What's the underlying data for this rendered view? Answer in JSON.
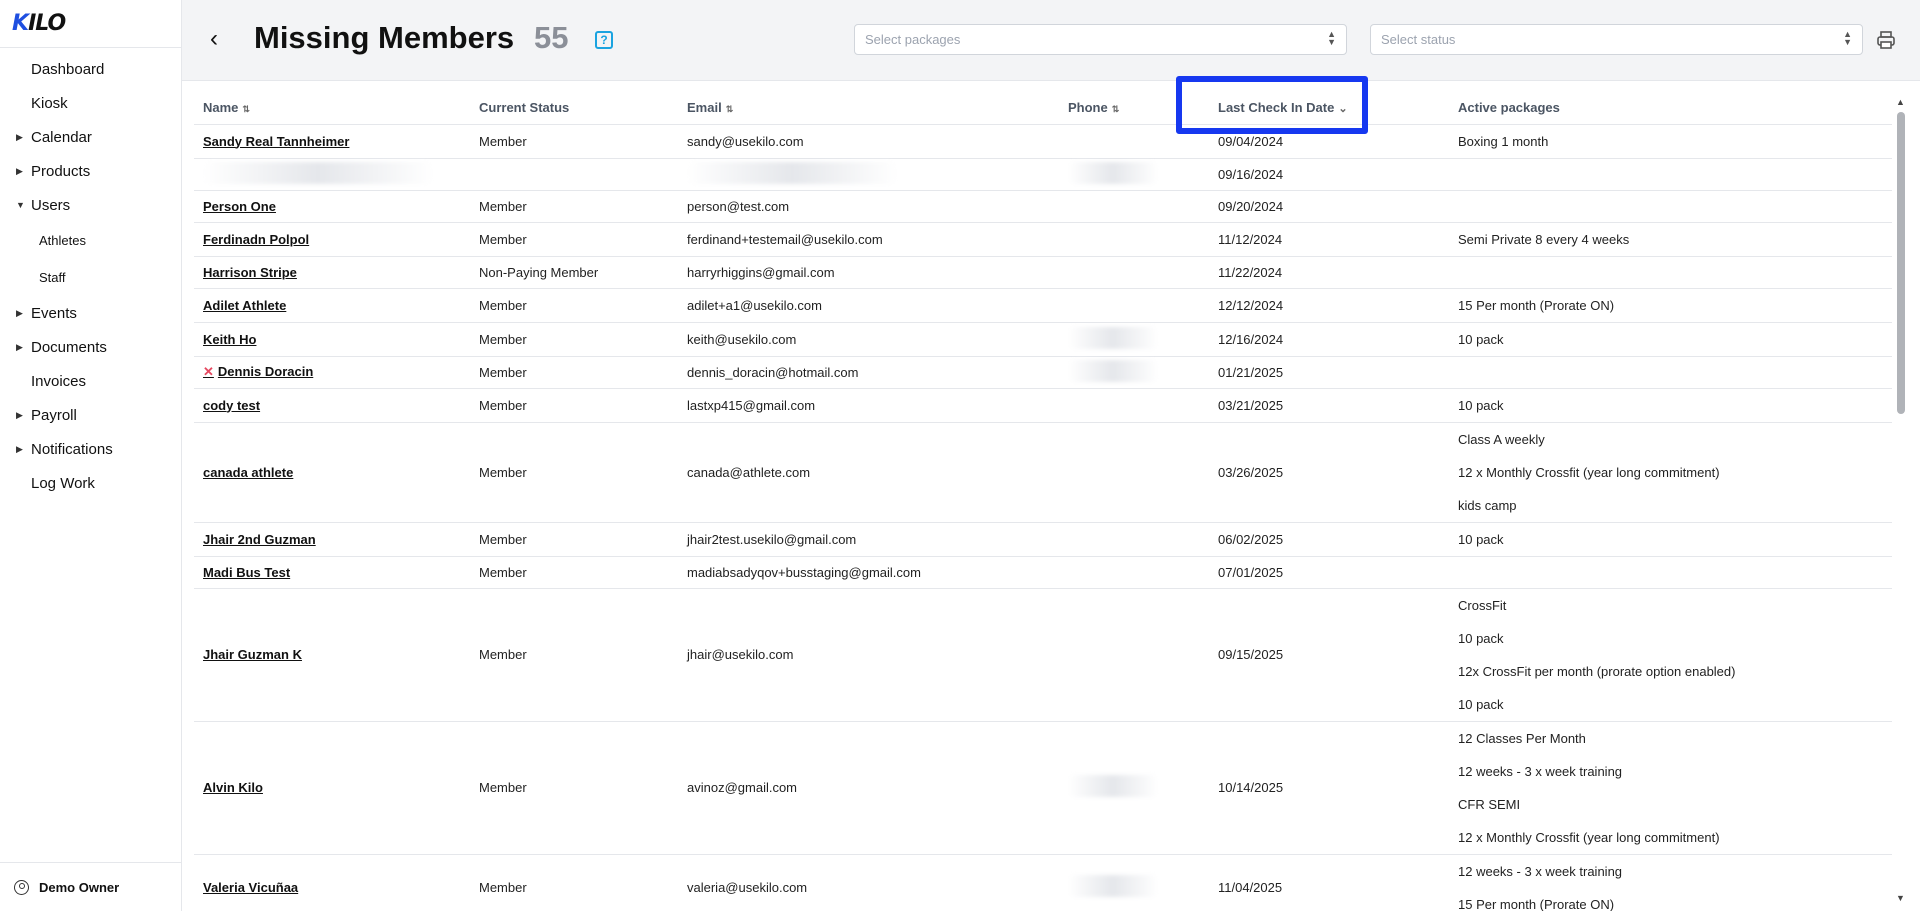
{
  "sidebar": {
    "logo": "KILO",
    "items": [
      {
        "label": "Dashboard"
      },
      {
        "label": "Kiosk"
      },
      {
        "label": "Calendar"
      },
      {
        "label": "Products"
      },
      {
        "label": "Users"
      },
      {
        "label": "Athletes"
      },
      {
        "label": "Staff"
      },
      {
        "label": "Events"
      },
      {
        "label": "Documents"
      },
      {
        "label": "Invoices"
      },
      {
        "label": "Payroll"
      },
      {
        "label": "Notifications"
      },
      {
        "label": "Log Work"
      }
    ],
    "user": "Demo Owner"
  },
  "header": {
    "title": "Missing Members",
    "count": "55",
    "help": "?",
    "packages_placeholder": "Select packages",
    "status_placeholder": "Select status"
  },
  "table": {
    "columns": [
      "Name",
      "Current Status",
      "Email",
      "Phone",
      "Last Check In Date",
      "Active packages"
    ],
    "rows": [
      {
        "name": "Sandy Real Tannheimer",
        "status": "Member",
        "email": "sandy@usekilo.com",
        "date": "09/04/2024",
        "packages": [
          "Boxing 1 month"
        ]
      },
      {
        "name": "",
        "status": "",
        "email": "",
        "date": "09/16/2024",
        "packages": []
      },
      {
        "name": "Person One",
        "status": "Member",
        "email": "person@test.com",
        "date": "09/20/2024",
        "packages": []
      },
      {
        "name": "Ferdinadn Polpol",
        "status": "Member",
        "email": "ferdinand+testemail@usekilo.com",
        "date": "11/12/2024",
        "packages": [
          "Semi Private 8 every 4 weeks"
        ]
      },
      {
        "name": "Harrison Stripe",
        "status": "Non-Paying Member",
        "email": "harryrhiggins@gmail.com",
        "date": "11/22/2024",
        "packages": []
      },
      {
        "name": "Adilet Athlete",
        "status": "Member",
        "email": "adilet+a1@usekilo.com",
        "date": "12/12/2024",
        "packages": [
          "15 Per month (Prorate ON)"
        ]
      },
      {
        "name": "Keith Ho",
        "status": "Member",
        "email": "keith@usekilo.com",
        "date": "12/16/2024",
        "packages": [
          "10 pack"
        ]
      },
      {
        "name": "Dennis Doracin",
        "status": "Member",
        "email": "dennis_doracin@hotmail.com",
        "date": "01/21/2025",
        "packages": []
      },
      {
        "name": "cody test",
        "status": "Member",
        "email": "lastxp415@gmail.com",
        "date": "03/21/2025",
        "packages": [
          "10 pack"
        ]
      },
      {
        "name": "canada athlete",
        "status": "Member",
        "email": "canada@athlete.com",
        "date": "03/26/2025",
        "packages": [
          "Class A weekly",
          "12 x Monthly Crossfit (year long commitment)",
          "kids camp"
        ]
      },
      {
        "name": "Jhair 2nd Guzman",
        "status": "Member",
        "email": "jhair2test.usekilo@gmail.com",
        "date": "06/02/2025",
        "packages": [
          "10 pack"
        ]
      },
      {
        "name": "Madi Bus Test",
        "status": "Member",
        "email": "madiabsadyqov+busstaging@gmail.com",
        "date": "07/01/2025",
        "packages": []
      },
      {
        "name": "Jhair Guzman K",
        "status": "Member",
        "email": "jhair@usekilo.com",
        "date": "09/15/2025",
        "packages": [
          "CrossFit",
          "10 pack",
          "12x CrossFit per month (prorate option enabled)",
          "10 pack"
        ]
      },
      {
        "name": "Alvin Kilo",
        "status": "Member",
        "email": "avinoz@gmail.com",
        "date": "10/14/2025",
        "packages": [
          "12 Classes Per Month",
          "12 weeks - 3 x week training",
          "CFR SEMI",
          "12 x Monthly Crossfit (year long commitment)"
        ]
      },
      {
        "name": "Valeria Vicuñaa",
        "status": "Member",
        "email": "valeria@usekilo.com",
        "date": "11/04/2025",
        "packages": [
          "12 weeks - 3 x week training",
          "15 Per month (Prorate ON)"
        ]
      }
    ]
  },
  "colors": {
    "accent": "#1638f0",
    "help": "#1aa3e0",
    "count": "#8b8f98"
  }
}
